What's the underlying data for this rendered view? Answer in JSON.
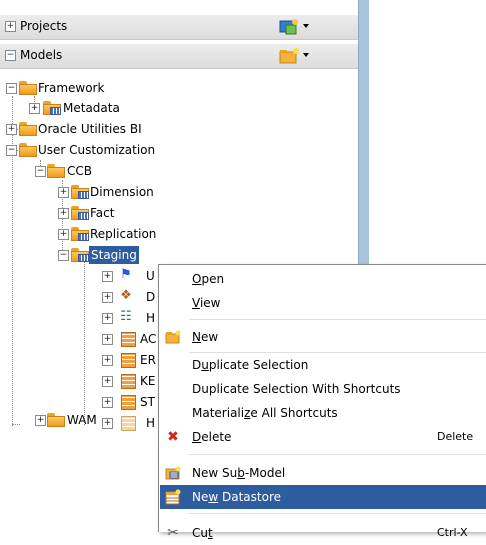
{
  "accordion": {
    "projects": {
      "expander": "+",
      "title": "Projects",
      "tool_icon": "new-project-icon"
    },
    "models": {
      "expander": "−",
      "title": "Models",
      "tool_icon": "new-model-folder-icon"
    }
  },
  "tree": {
    "framework": {
      "label": "Framework",
      "expander": "−"
    },
    "metadata": {
      "label": "Metadata",
      "expander": "+"
    },
    "oracle_bi": {
      "label": "Oracle Utilities BI",
      "expander": "+"
    },
    "user_custom": {
      "label": "User Customization",
      "expander": "−"
    },
    "ccb": {
      "label": "CCB",
      "expander": "−"
    },
    "dimension": {
      "label": "Dimension",
      "expander": "+"
    },
    "fact": {
      "label": "Fact",
      "expander": "+"
    },
    "replication": {
      "label": "Replication",
      "expander": "+"
    },
    "staging": {
      "label": "Staging",
      "expander": "−"
    },
    "staging_children": [
      {
        "label": "U",
        "expander": "+",
        "icon": "flag-icon"
      },
      {
        "label": "D",
        "expander": "+",
        "icon": "diagram-icon"
      },
      {
        "label": "H",
        "expander": "+",
        "icon": "hierarchy-icon"
      },
      {
        "label": "AC",
        "expander": "+",
        "icon": "table-icon"
      },
      {
        "label": "ER",
        "expander": "+",
        "icon": "table-icon"
      },
      {
        "label": "KE",
        "expander": "+",
        "icon": "table-icon"
      },
      {
        "label": "ST",
        "expander": "+",
        "icon": "table-icon"
      },
      {
        "label": "H",
        "expander": "+",
        "icon": "table-icon"
      }
    ],
    "wam": {
      "label": "WAM",
      "expander": "+"
    }
  },
  "context_menu": {
    "open": {
      "pre": "",
      "mnemonic": "O",
      "post": "pen"
    },
    "view": {
      "pre": "",
      "mnemonic": "V",
      "post": "iew"
    },
    "new": {
      "pre": "",
      "mnemonic": "N",
      "post": "ew"
    },
    "duplicate_selection": {
      "pre": "D",
      "mnemonic": "u",
      "post": "plicate Selection"
    },
    "duplicate_with_shortcuts": {
      "label": "Duplicate Selection With Shortcuts"
    },
    "materialize": {
      "pre": "Materiali",
      "mnemonic": "z",
      "post": "e All Shortcuts"
    },
    "delete": {
      "pre": "",
      "mnemonic": "D",
      "post": "elete",
      "accelerator": "Delete"
    },
    "new_submodel": {
      "pre": "New Su",
      "mnemonic": "b",
      "post": "-Model"
    },
    "new_datastore": {
      "pre": "Ne",
      "mnemonic": "w",
      "post": " Datastore"
    },
    "cut": {
      "pre": "Cu",
      "mnemonic": "t",
      "post": "",
      "accelerator": "Ctrl-X"
    }
  },
  "colors": {
    "selection": "#2d5c9f",
    "splitter": "#a9c3dd",
    "folder": "#f2a92a"
  }
}
